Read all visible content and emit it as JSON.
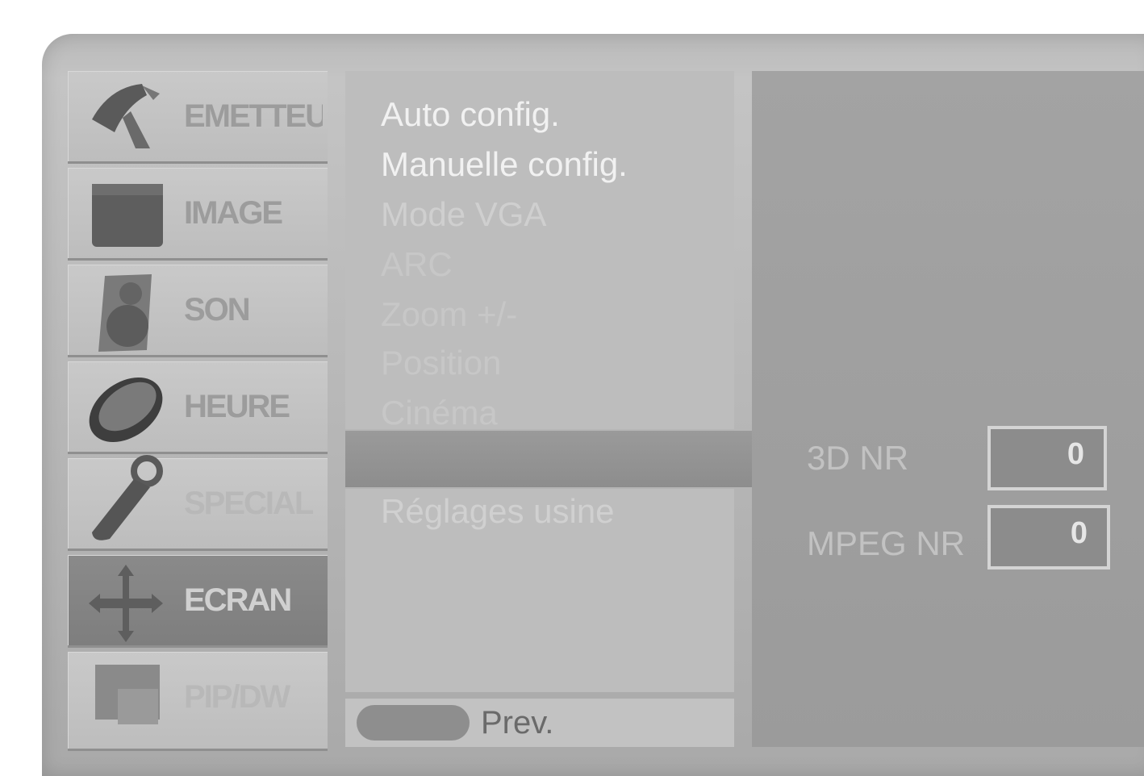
{
  "categories": [
    {
      "label": "EMETTEUR",
      "icon": "satellite-dish-icon"
    },
    {
      "label": "IMAGE",
      "icon": "picture-icon"
    },
    {
      "label": "SON",
      "icon": "speaker-icon"
    },
    {
      "label": "HEURE",
      "icon": "clock-icon"
    },
    {
      "label": "SPECIAL",
      "icon": "key-tag-icon"
    },
    {
      "label": "ECRAN",
      "icon": "move-arrows-icon"
    },
    {
      "label": "PIP/DW",
      "icon": "pip-icon"
    }
  ],
  "active_category": "ECRAN",
  "menu": {
    "items": [
      "Auto config.",
      "Manuelle config.",
      "Mode VGA",
      "ARC",
      "Zoom +/-",
      "Position",
      "Cinéma",
      "",
      "Réglages usine"
    ]
  },
  "footer": {
    "prev_label": "Prev."
  },
  "noise_reduction": {
    "nr3d_label": "3D NR",
    "nr3d_value": "0",
    "mpeg_label": "MPEG NR",
    "mpeg_value": "0"
  }
}
